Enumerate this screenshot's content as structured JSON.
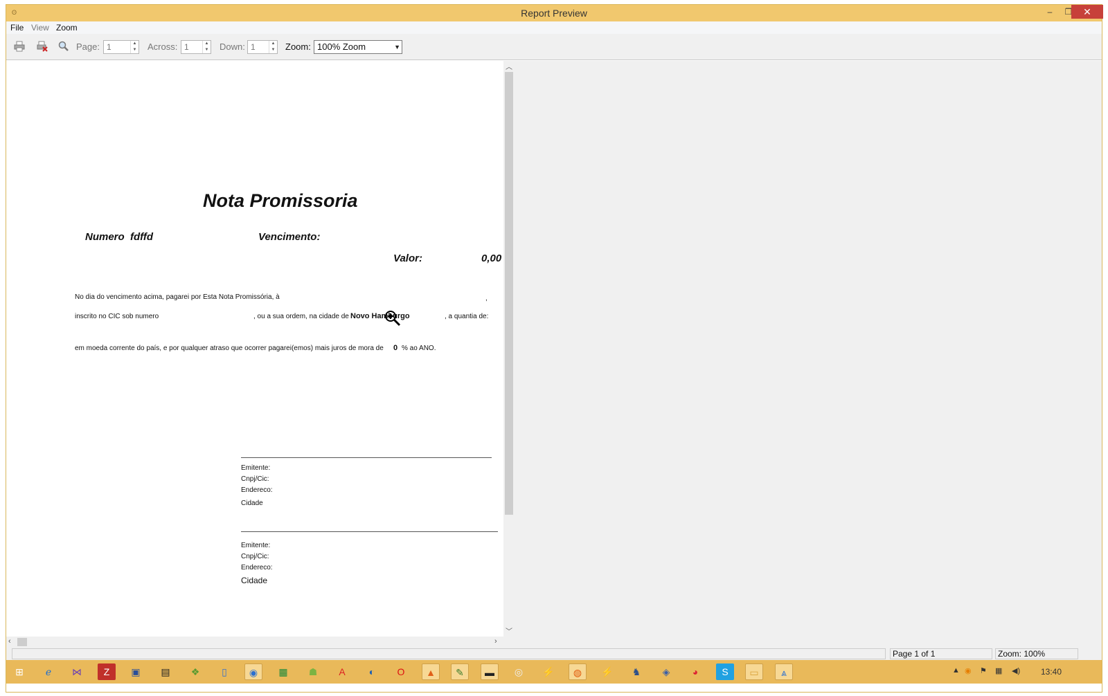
{
  "window": {
    "title": "Report Preview",
    "min_label": "–",
    "max_label": "❐",
    "close_label": "✕"
  },
  "menu": {
    "file": "File",
    "view": "View",
    "zoom": "Zoom"
  },
  "toolbar": {
    "page_label": "Page:",
    "page_value": "1",
    "across_label": "Across:",
    "across_value": "1",
    "down_label": "Down:",
    "down_value": "1",
    "zoom_label": "Zoom:",
    "zoom_value": "100% Zoom",
    "icons": [
      "printer-icon",
      "printer-delete-icon",
      "magnifier-icon"
    ]
  },
  "report": {
    "title": "Nota Promissoria",
    "numero_label": "Numero",
    "numero_value": "fdffd",
    "vencimento_label": "Vencimento:",
    "valor_label": "Valor:",
    "valor_value": "0,00",
    "line1": "No dia do vencimento acima, pagarei por Esta Nota Promissória, à",
    "line1_end": ",",
    "line2_a": "inscrito no CIC sob numero",
    "line2_b": ", ou a sua ordem, na cidade de",
    "city": "Novo Hamburgo",
    "line2_c": ", a quantia de:",
    "line3": "em moeda corrente do país, e por qualquer atraso que ocorrer pagarei(emos) mais juros de mora de",
    "juros": "0",
    "line3_end": "% ao ANO.",
    "sig1": {
      "emitente": "Emitente:",
      "cnpj": "Cnpj/Cic:",
      "endereco": "Endereco:",
      "cidade": "Cidade"
    },
    "sig2": {
      "emitente": "Emitente:",
      "cnpj": "Cnpj/Cic:",
      "endereco": "Endereco:",
      "cidade": "Cidade"
    }
  },
  "status": {
    "page": "Page 1 of 1",
    "zoom": "Zoom: 100%"
  },
  "taskbar": {
    "apps": [
      "windows-start",
      "internet-explorer",
      "visual-studio",
      "filezilla",
      "remote-desktop",
      "terminal",
      "file-manager",
      "notepad",
      "chrome-like",
      "green-app",
      "android-app",
      "acrobat",
      "globe-app",
      "opera",
      "matlab",
      "sticky-notes",
      "cmd",
      "cd-drive",
      "winamp",
      "firefox",
      "winamp-2",
      "postgres",
      "virtualbox",
      "chrome",
      "skype",
      "explorer",
      "report-app"
    ],
    "clock": "13:40"
  }
}
